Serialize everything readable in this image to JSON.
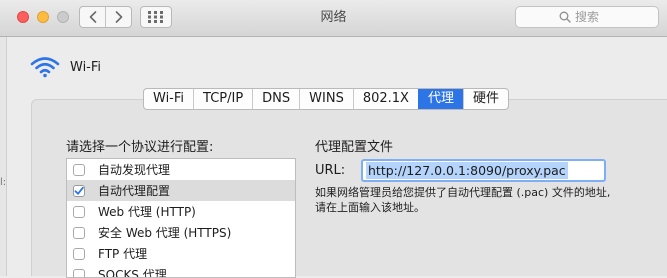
{
  "window": {
    "title": "网络",
    "search_placeholder": "搜索"
  },
  "left_edge_text": "l:",
  "interface": {
    "name": "Wi-Fi"
  },
  "tabs": [
    {
      "label": "Wi-Fi",
      "active": false
    },
    {
      "label": "TCP/IP",
      "active": false
    },
    {
      "label": "DNS",
      "active": false
    },
    {
      "label": "WINS",
      "active": false
    },
    {
      "label": "802.1X",
      "active": false
    },
    {
      "label": "代理",
      "active": true
    },
    {
      "label": "硬件",
      "active": false
    }
  ],
  "protocols": {
    "heading": "请选择一个协议进行配置:",
    "items": [
      {
        "label": "自动发现代理",
        "checked": false,
        "selected": false
      },
      {
        "label": "自动代理配置",
        "checked": true,
        "selected": true
      },
      {
        "label": "Web 代理 (HTTP)",
        "checked": false,
        "selected": false
      },
      {
        "label": "安全 Web 代理 (HTTPS)",
        "checked": false,
        "selected": false
      },
      {
        "label": "FTP 代理",
        "checked": false,
        "selected": false
      },
      {
        "label": "SOCKS 代理",
        "checked": false,
        "selected": false
      }
    ]
  },
  "config": {
    "heading": "代理配置文件",
    "url_label": "URL:",
    "url_value": "http://127.0.0.1:8090/proxy.pac",
    "help_line1": "如果网络管理员给您提供了自动代理配置 (.pac) 文件的地址,",
    "help_line2": "请在上面输入该地址。"
  },
  "colors": {
    "accent": "#2d74e7",
    "selection": "#b4d4fb",
    "focus_ring": "#7eaef3"
  }
}
